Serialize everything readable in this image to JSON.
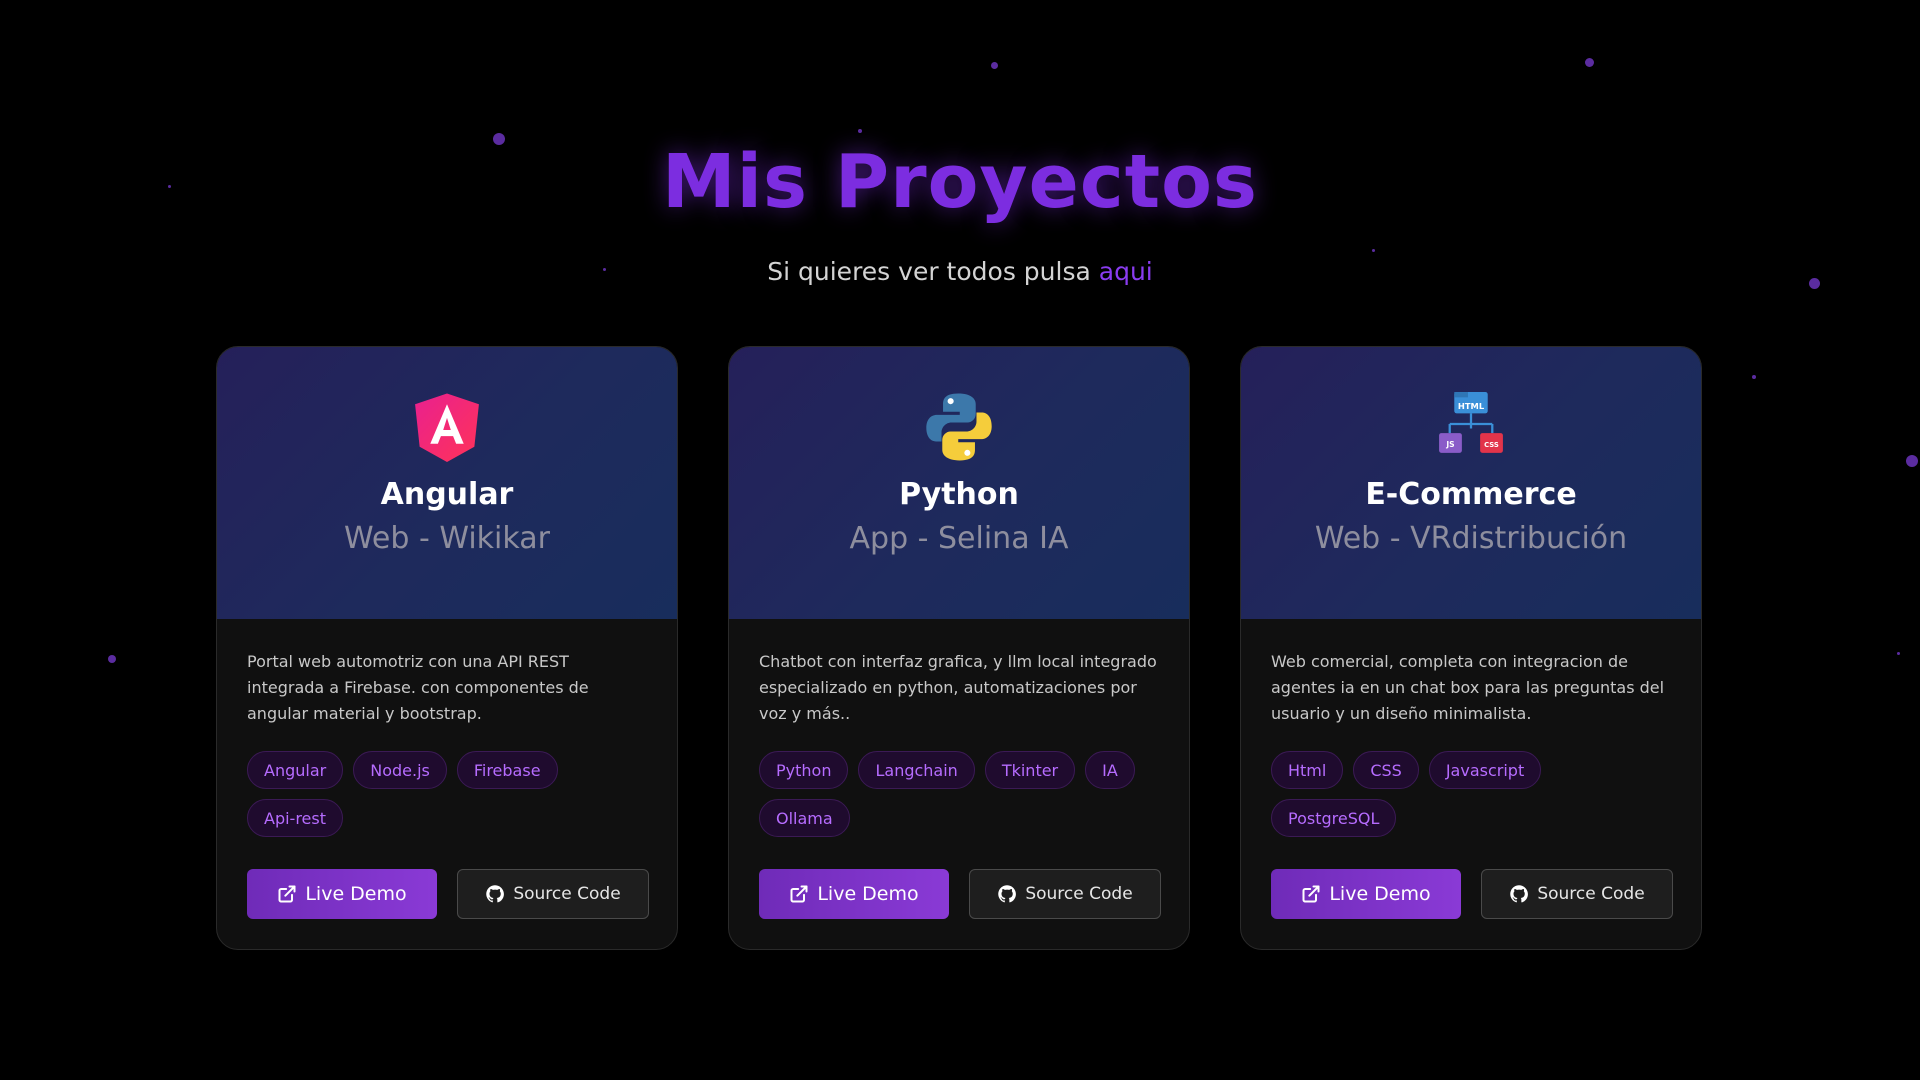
{
  "header": {
    "title": "Mis Proyectos",
    "subtitle_text": "Si quieres ver todos pulsa",
    "subtitle_link": "aqui"
  },
  "projects": [
    {
      "icon": "angular-logo-icon",
      "name": "Angular",
      "subtitle": "Web - Wikikar",
      "description": "Portal web automotriz con una API REST integrada a Firebase. con componentes de angular material y bootstrap.",
      "tags": [
        "Angular",
        "Node.js",
        "Firebase",
        "Api-rest"
      ],
      "demo_label": "Live Demo",
      "source_label": "Source Code"
    },
    {
      "icon": "python-logo-icon",
      "name": "Python",
      "subtitle": "App - Selina IA",
      "description": "Chatbot con interfaz grafica, y llm local integrado especializado en python, automatizaciones por voz y más..",
      "tags": [
        "Python",
        "Langchain",
        "Tkinter",
        "IA",
        "Ollama"
      ],
      "demo_label": "Live Demo",
      "source_label": "Source Code"
    },
    {
      "icon": "web-stack-icon",
      "name": "E-Commerce",
      "subtitle": "Web - VRdistribución",
      "description": "Web comercial, completa con integracion de agentes ia en un chat box para las preguntas del usuario y un diseño minimalista.",
      "tags": [
        "Html",
        "CSS",
        "Javascript",
        "PostgreSQL"
      ],
      "demo_label": "Live Demo",
      "source_label": "Source Code"
    }
  ],
  "colors": {
    "accent": "#7c2de0",
    "tag_text": "#b66cff",
    "card_bg": "#101010"
  }
}
